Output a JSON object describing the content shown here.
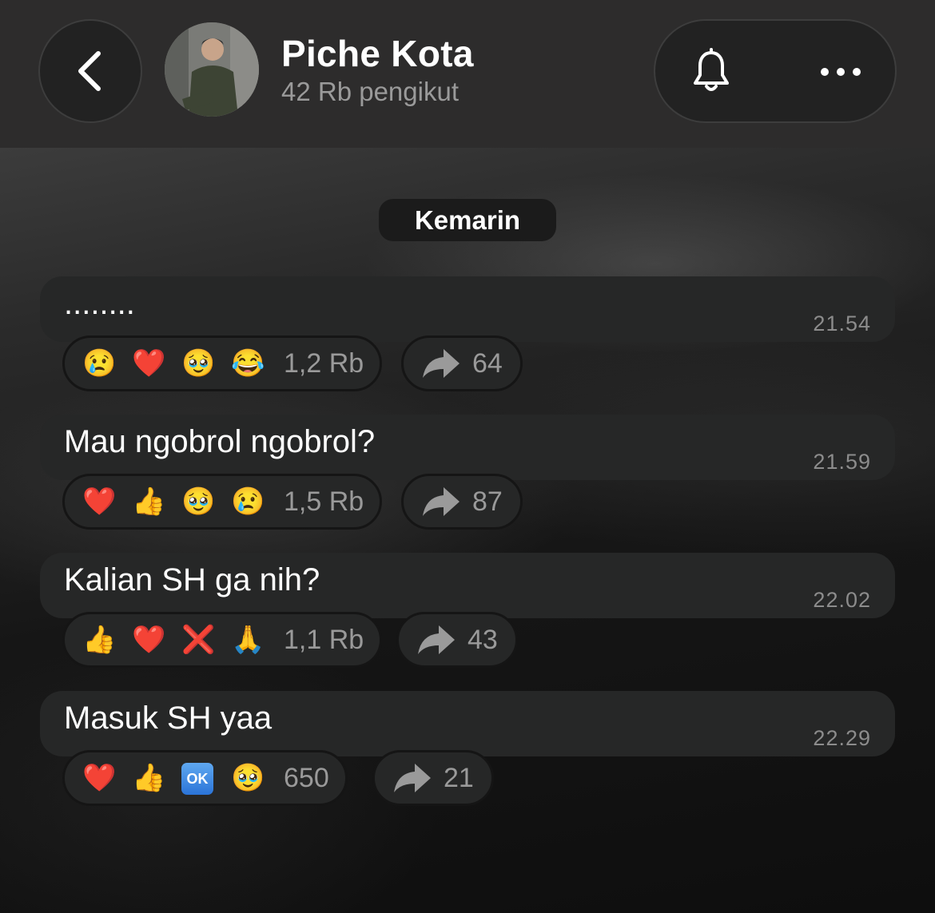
{
  "header": {
    "channel_name": "Piche Kota",
    "followers": "42 Rb pengikut"
  },
  "date_chip": "Kemarin",
  "messages": [
    {
      "text": "........",
      "time": "21.54",
      "reactions": [
        "😢",
        "❤️",
        "🥹",
        "😂"
      ],
      "reaction_count": "1,2 Rb",
      "share_count": "64"
    },
    {
      "text": "Mau ngobrol ngobrol?",
      "time": "21.59",
      "reactions": [
        "❤️",
        "👍",
        "🥹",
        "😢"
      ],
      "reaction_count": "1,5 Rb",
      "share_count": "87"
    },
    {
      "text": "Kalian SH ga nih?",
      "time": "22.02",
      "reactions": [
        "👍",
        "❤️",
        "❌",
        "🙏"
      ],
      "reaction_count": "1,1 Rb",
      "share_count": "43"
    },
    {
      "text": "Masuk SH yaa",
      "time": "22.29",
      "reactions": [
        "❤️",
        "👍",
        "OK",
        "🥹"
      ],
      "reaction_count": "650",
      "share_count": "21"
    }
  ]
}
